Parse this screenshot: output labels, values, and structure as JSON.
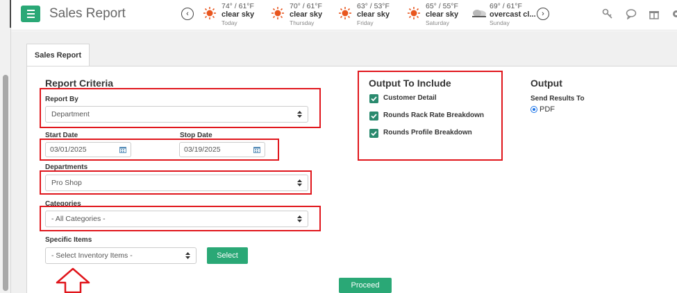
{
  "header": {
    "title": "Sales Report",
    "weather": [
      {
        "temp": "74° / 61°F",
        "desc": "clear sky",
        "day": "Today",
        "icon": "sun-icon"
      },
      {
        "temp": "70° / 61°F",
        "desc": "clear sky",
        "day": "Thursday",
        "icon": "sun-icon"
      },
      {
        "temp": "63° / 53°F",
        "desc": "clear sky",
        "day": "Friday",
        "icon": "sun-icon"
      },
      {
        "temp": "65° / 55°F",
        "desc": "clear sky",
        "day": "Saturday",
        "icon": "sun-icon"
      },
      {
        "temp": "69° / 61°F",
        "desc": "overcast cl...",
        "day": "Sunday",
        "icon": "cloud-icon"
      }
    ],
    "icons": [
      "key-icon",
      "chat-icon",
      "gift-icon",
      "gear-icon"
    ]
  },
  "tab": {
    "label": "Sales Report"
  },
  "criteria": {
    "title": "Report Criteria",
    "report_by": {
      "label": "Report By",
      "value": "Department"
    },
    "start_date": {
      "label": "Start Date",
      "value": "03/01/2025"
    },
    "stop_date": {
      "label": "Stop Date",
      "value": "03/19/2025"
    },
    "departments": {
      "label": "Departments",
      "value": "Pro Shop"
    },
    "categories": {
      "label": "Categories",
      "value": "- All Categories -"
    },
    "specific_items": {
      "label": "Specific Items",
      "value": "- Select Inventory Items -",
      "button": "Select"
    }
  },
  "output_include": {
    "title": "Output To Include",
    "options": [
      {
        "label": "Customer Detail",
        "checked": true
      },
      {
        "label": "Rounds Rack Rate Breakdown",
        "checked": true
      },
      {
        "label": "Rounds Profile Breakdown",
        "checked": true
      }
    ]
  },
  "output": {
    "title": "Output",
    "send_label": "Send Results To",
    "option": "PDF"
  },
  "proceed": "Proceed",
  "colors": {
    "accent": "#2aa876",
    "highlight": "#e0151b",
    "checkbox": "#2a8a6e"
  }
}
